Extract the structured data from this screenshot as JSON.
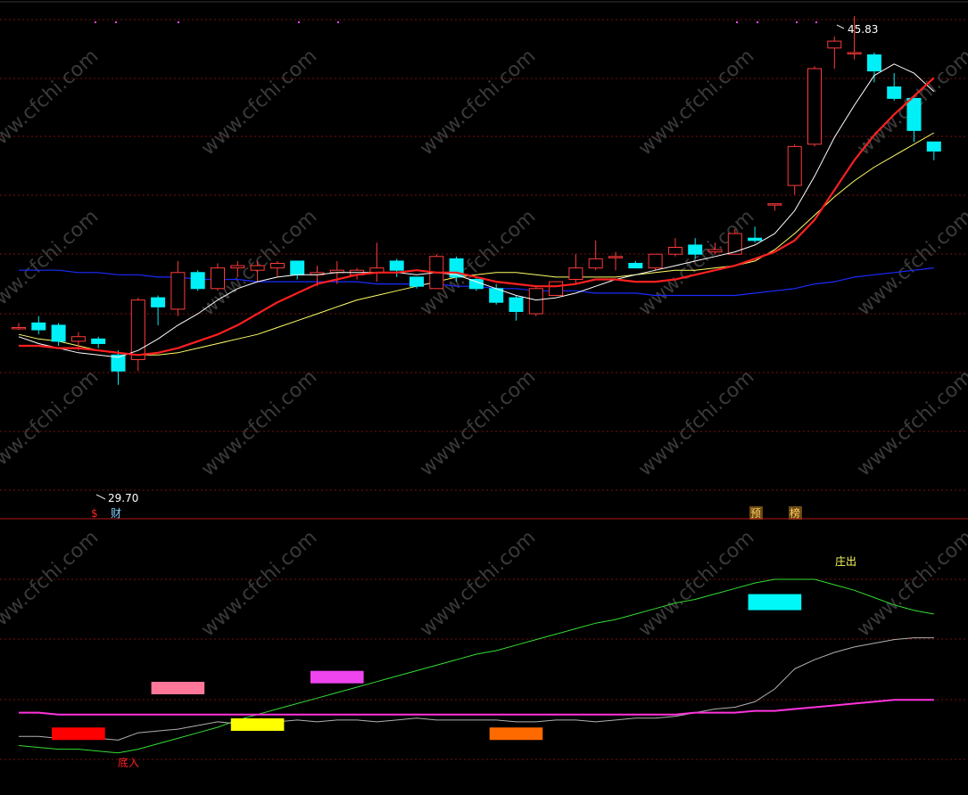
{
  "watermark": "www.cfchi.com",
  "colors": {
    "background": "#000000",
    "grid": "#7a1010",
    "divider": "#b01a1a",
    "up_candle": "#ff3a3a",
    "down_candle": "#00f0f8",
    "ma_white": "#ffffff",
    "ma_red": "#ff2020",
    "ma_yellow": "#ffff66",
    "ma_blue": "#1a2bff",
    "osc_green": "#33dd33",
    "osc_gray": "#b0b0b0",
    "osc_magenta": "#ff33dd",
    "label_red": "#ff2020",
    "label_yellow": "#ffff66",
    "marker_dot": "#ff44ff"
  },
  "chart_data": [
    {
      "type": "candlestick",
      "title": "",
      "xlabel": "",
      "ylabel": "",
      "ylim": [
        25.1,
        46.3
      ],
      "grid": true,
      "annotations": {
        "high": "45.83",
        "low": "29.70",
        "events": [
          "$",
          "财",
          "预",
          "榜"
        ]
      },
      "candles": [
        {
          "o": 32.2,
          "h": 32.4,
          "l": 32.1,
          "c": 32.2
        },
        {
          "o": 32.4,
          "h": 32.7,
          "l": 31.9,
          "c": 32.1
        },
        {
          "o": 32.3,
          "h": 32.4,
          "l": 31.4,
          "c": 31.6
        },
        {
          "o": 31.6,
          "h": 32.0,
          "l": 31.2,
          "c": 31.8
        },
        {
          "o": 31.7,
          "h": 31.8,
          "l": 31.3,
          "c": 31.5
        },
        {
          "o": 31.0,
          "h": 31.2,
          "l": 29.7,
          "c": 30.3
        },
        {
          "o": 30.8,
          "h": 33.5,
          "l": 30.3,
          "c": 33.4
        },
        {
          "o": 33.5,
          "h": 33.6,
          "l": 32.3,
          "c": 33.1
        },
        {
          "o": 33.0,
          "h": 35.1,
          "l": 32.7,
          "c": 34.6
        },
        {
          "o": 34.6,
          "h": 34.7,
          "l": 33.8,
          "c": 33.9
        },
        {
          "o": 33.9,
          "h": 35.0,
          "l": 33.8,
          "c": 34.8
        },
        {
          "o": 34.8,
          "h": 35.1,
          "l": 34.4,
          "c": 34.9
        },
        {
          "o": 34.7,
          "h": 35.1,
          "l": 34.2,
          "c": 34.9
        },
        {
          "o": 34.8,
          "h": 35.1,
          "l": 34.4,
          "c": 35.0
        },
        {
          "o": 35.1,
          "h": 35.1,
          "l": 34.3,
          "c": 34.5
        },
        {
          "o": 34.5,
          "h": 34.9,
          "l": 34.0,
          "c": 34.6
        },
        {
          "o": 34.6,
          "h": 35.1,
          "l": 34.1,
          "c": 34.7
        },
        {
          "o": 34.5,
          "h": 34.8,
          "l": 34.3,
          "c": 34.7
        },
        {
          "o": 34.6,
          "h": 35.9,
          "l": 34.2,
          "c": 34.8
        },
        {
          "o": 35.1,
          "h": 35.2,
          "l": 34.4,
          "c": 34.7
        },
        {
          "o": 34.4,
          "h": 34.4,
          "l": 33.9,
          "c": 34.0
        },
        {
          "o": 33.9,
          "h": 35.4,
          "l": 33.9,
          "c": 35.3
        },
        {
          "o": 35.2,
          "h": 35.3,
          "l": 34.2,
          "c": 34.4
        },
        {
          "o": 34.3,
          "h": 34.4,
          "l": 33.8,
          "c": 33.9
        },
        {
          "o": 33.9,
          "h": 34.1,
          "l": 33.2,
          "c": 33.3
        },
        {
          "o": 33.5,
          "h": 33.6,
          "l": 32.5,
          "c": 32.9
        },
        {
          "o": 32.8,
          "h": 34.0,
          "l": 32.7,
          "c": 33.9
        },
        {
          "o": 33.6,
          "h": 34.2,
          "l": 33.6,
          "c": 34.2
        },
        {
          "o": 34.3,
          "h": 35.4,
          "l": 34.1,
          "c": 34.8
        },
        {
          "o": 34.8,
          "h": 36.0,
          "l": 34.7,
          "c": 35.2
        },
        {
          "o": 35.3,
          "h": 35.5,
          "l": 34.7,
          "c": 35.3
        },
        {
          "o": 35.0,
          "h": 35.1,
          "l": 34.8,
          "c": 34.8
        },
        {
          "o": 34.8,
          "h": 35.4,
          "l": 34.7,
          "c": 35.4
        },
        {
          "o": 35.4,
          "h": 36.1,
          "l": 35.3,
          "c": 35.7
        },
        {
          "o": 35.8,
          "h": 36.1,
          "l": 35.2,
          "c": 35.4
        },
        {
          "o": 35.5,
          "h": 35.9,
          "l": 35.4,
          "c": 35.6
        },
        {
          "o": 35.4,
          "h": 36.5,
          "l": 35.4,
          "c": 36.3
        },
        {
          "o": 36.1,
          "h": 36.6,
          "l": 35.9,
          "c": 36.0
        },
        {
          "o": 37.6,
          "h": 37.6,
          "l": 37.3,
          "c": 37.6
        },
        {
          "o": 38.4,
          "h": 40.2,
          "l": 38.0,
          "c": 40.1
        },
        {
          "o": 40.2,
          "h": 43.6,
          "l": 40.1,
          "c": 43.5
        },
        {
          "o": 44.4,
          "h": 44.9,
          "l": 43.5,
          "c": 44.7
        },
        {
          "o": 44.2,
          "h": 45.8,
          "l": 43.9,
          "c": 44.2
        },
        {
          "o": 44.1,
          "h": 44.2,
          "l": 42.9,
          "c": 43.4
        },
        {
          "o": 42.7,
          "h": 43.3,
          "l": 42.1,
          "c": 42.2
        },
        {
          "o": 42.2,
          "h": 42.2,
          "l": 40.3,
          "c": 40.8
        },
        {
          "o": 40.3,
          "h": 40.3,
          "l": 39.5,
          "c": 39.9
        }
      ],
      "ma_white": [
        31.8,
        31.5,
        31.3,
        31.1,
        31.0,
        30.9,
        31.2,
        31.7,
        32.3,
        32.8,
        33.4,
        33.9,
        34.2,
        34.4,
        34.5,
        34.5,
        34.6,
        34.6,
        34.6,
        34.6,
        34.5,
        34.6,
        34.5,
        34.2,
        33.9,
        33.6,
        33.4,
        33.5,
        33.7,
        34.0,
        34.3,
        34.5,
        34.7,
        34.9,
        35.1,
        35.3,
        35.5,
        35.8,
        36.3,
        37.3,
        38.8,
        40.5,
        41.9,
        43.2,
        43.7,
        43.3,
        42.5
      ],
      "ma_red": [
        31.4,
        31.4,
        31.3,
        31.3,
        31.2,
        31.1,
        31.0,
        31.1,
        31.3,
        31.6,
        31.9,
        32.3,
        32.8,
        33.3,
        33.7,
        34.1,
        34.3,
        34.5,
        34.6,
        34.6,
        34.7,
        34.6,
        34.6,
        34.4,
        34.2,
        34.1,
        34.0,
        34.0,
        34.1,
        34.3,
        34.3,
        34.2,
        34.2,
        34.3,
        34.5,
        34.7,
        34.9,
        35.2,
        35.5,
        36.0,
        36.9,
        38.2,
        39.5,
        40.6,
        41.5,
        42.3,
        43.1
      ],
      "ma_yellow": [
        31.9,
        31.7,
        31.6,
        31.4,
        31.2,
        31.1,
        31.0,
        31.0,
        31.1,
        31.3,
        31.5,
        31.7,
        31.9,
        32.2,
        32.5,
        32.8,
        33.1,
        33.4,
        33.6,
        33.8,
        34.0,
        34.2,
        34.4,
        34.5,
        34.6,
        34.6,
        34.5,
        34.4,
        34.4,
        34.4,
        34.4,
        34.5,
        34.6,
        34.7,
        34.7,
        34.8,
        34.9,
        35.1,
        35.6,
        36.3,
        37.1,
        37.9,
        38.6,
        39.2,
        39.7,
        40.2,
        40.7
      ],
      "ma_blue": [
        34.7,
        34.7,
        34.7,
        34.6,
        34.6,
        34.5,
        34.5,
        34.4,
        34.4,
        34.3,
        34.3,
        34.3,
        34.2,
        34.2,
        34.2,
        34.2,
        34.2,
        34.2,
        34.1,
        34.1,
        34.1,
        34.1,
        34.0,
        34.0,
        33.9,
        33.9,
        33.8,
        33.8,
        33.8,
        33.7,
        33.7,
        33.7,
        33.6,
        33.6,
        33.6,
        33.6,
        33.6,
        33.7,
        33.8,
        33.9,
        34.1,
        34.2,
        34.4,
        34.5,
        34.6,
        34.7,
        34.8
      ]
    },
    {
      "type": "line",
      "title": "",
      "xlabel": "",
      "ylabel": "",
      "ylim": [
        0,
        100
      ],
      "grid": true,
      "annotations": {
        "bottom": "底入",
        "top": "庄出"
      },
      "series": [
        {
          "values": [
            9,
            8,
            7,
            7,
            6,
            5,
            7,
            10,
            13,
            16,
            19,
            23,
            26,
            29,
            32,
            35,
            38,
            41,
            44,
            47,
            50,
            53,
            56,
            59,
            61,
            64,
            67,
            70,
            73,
            76,
            78,
            81,
            84,
            87,
            89,
            92,
            95,
            98,
            100,
            100,
            100,
            97,
            94,
            90,
            86,
            83,
            81
          ]
        },
        {
          "values": [
            14,
            14,
            13,
            13,
            13,
            12,
            16,
            17,
            18,
            20,
            22,
            21,
            22,
            22,
            23,
            22,
            23,
            23,
            22,
            23,
            24,
            23,
            23,
            23,
            23,
            22,
            22,
            23,
            23,
            22,
            23,
            24,
            24,
            25,
            27,
            29,
            30,
            33,
            40,
            51,
            56,
            60,
            63,
            65,
            67,
            68,
            68
          ]
        },
        {
          "values": [
            27,
            27,
            26,
            26,
            26,
            26,
            26,
            26,
            26,
            26,
            26,
            26,
            26,
            26,
            26,
            26,
            26,
            26,
            26,
            26,
            26,
            26,
            26,
            26,
            26,
            26,
            26,
            26,
            26,
            26,
            26,
            26,
            26,
            26,
            27,
            27,
            27,
            28,
            28,
            29,
            30,
            31,
            32,
            33,
            34,
            34,
            34
          ]
        }
      ],
      "blocks": [
        {
          "start": 2,
          "end": 4,
          "level": 15,
          "color": "#ff0000"
        },
        {
          "start": 7,
          "end": 9,
          "level": 40,
          "color": "#ff7799"
        },
        {
          "start": 11,
          "end": 13,
          "level": 20,
          "color": "#ffff00"
        },
        {
          "start": 15,
          "end": 17,
          "level": 46,
          "color": "#ee44ee"
        },
        {
          "start": 24,
          "end": 26,
          "level": 15,
          "color": "#ff6a00"
        },
        {
          "start": 37,
          "end": 39,
          "level": 88,
          "color": "#00f8f8"
        }
      ]
    }
  ]
}
